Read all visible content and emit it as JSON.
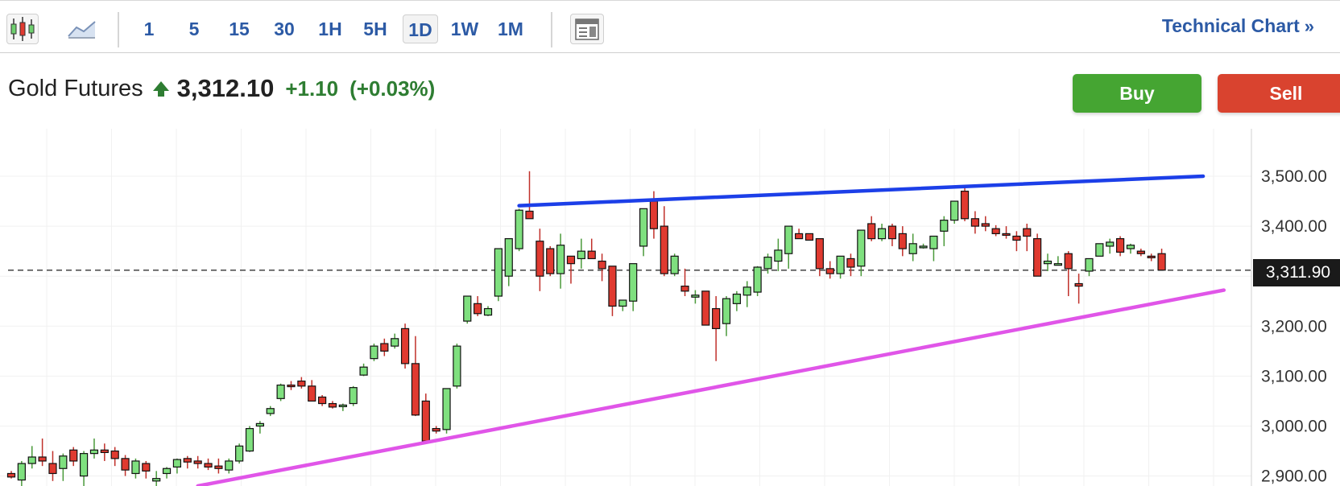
{
  "toolbar": {
    "chart_type_icons": [
      "candlestick-icon",
      "area-chart-icon"
    ],
    "intervals": [
      "1",
      "5",
      "15",
      "30",
      "1H",
      "5H",
      "1D",
      "1W",
      "1M"
    ],
    "active_interval": "1D",
    "layout_icon": "layout-icon",
    "technical_chart_label": "Technical Chart",
    "technical_chart_arrow": "»"
  },
  "quote": {
    "name": "Gold Futures",
    "direction_icon": "arrow-up-icon",
    "price": "3,312.10",
    "change": "+1.10",
    "change_pct": "(+0.03%)",
    "positive_color": "#2e7d32"
  },
  "actions": {
    "buy_label": "Buy",
    "sell_label": "Sell",
    "buy_color": "#45a532",
    "sell_color": "#d9432f"
  },
  "chart_data": {
    "type": "candlestick",
    "instrument": "Gold Futures",
    "interval": "1D",
    "y_ticks": [
      "3,500.00",
      "3,400.00",
      "3,300.00",
      "3,200.00",
      "3,100.00",
      "3,000.00",
      "2,900.00"
    ],
    "y_tick_values": [
      3500,
      3400,
      3300,
      3200,
      3100,
      3000,
      2900
    ],
    "ylim": [
      2880,
      3595
    ],
    "grid": true,
    "current_price_label": "3,311.90",
    "current_price": 3311.9,
    "up_color": "#7fe07f",
    "down_color": "#e03a30",
    "candles": [
      [
        2905,
        2910,
        2895,
        2898
      ],
      [
        2892,
        2930,
        2880,
        2925
      ],
      [
        2925,
        2960,
        2915,
        2938
      ],
      [
        2938,
        2975,
        2920,
        2930
      ],
      [
        2925,
        2950,
        2890,
        2905
      ],
      [
        2915,
        2945,
        2890,
        2940
      ],
      [
        2952,
        2958,
        2920,
        2930
      ],
      [
        2900,
        2950,
        2880,
        2945
      ],
      [
        2945,
        2975,
        2935,
        2952
      ],
      [
        2952,
        2965,
        2930,
        2947
      ],
      [
        2950,
        2958,
        2920,
        2935
      ],
      [
        2935,
        2942,
        2900,
        2912
      ],
      [
        2905,
        2935,
        2895,
        2930
      ],
      [
        2925,
        2930,
        2895,
        2910
      ],
      [
        2890,
        2910,
        2878,
        2895
      ],
      [
        2905,
        2918,
        2895,
        2915
      ],
      [
        2918,
        2935,
        2905,
        2933
      ],
      [
        2935,
        2940,
        2915,
        2928
      ],
      [
        2930,
        2940,
        2915,
        2925
      ],
      [
        2925,
        2935,
        2912,
        2918
      ],
      [
        2920,
        2935,
        2905,
        2915
      ],
      [
        2912,
        2935,
        2905,
        2930
      ],
      [
        2930,
        2965,
        2925,
        2960
      ],
      [
        2950,
        3000,
        2948,
        2995
      ],
      [
        3000,
        3010,
        2985,
        3005
      ],
      [
        3025,
        3040,
        3020,
        3035
      ],
      [
        3055,
        3085,
        3050,
        3082
      ],
      [
        3082,
        3090,
        3072,
        3080
      ],
      [
        3090,
        3098,
        3075,
        3080
      ],
      [
        3080,
        3092,
        3050,
        3050
      ],
      [
        3058,
        3062,
        3040,
        3045
      ],
      [
        3045,
        3050,
        3035,
        3038
      ],
      [
        3040,
        3045,
        3030,
        3042
      ],
      [
        3045,
        3080,
        3040,
        3077
      ],
      [
        3102,
        3125,
        3100,
        3118
      ],
      [
        3135,
        3165,
        3130,
        3160
      ],
      [
        3165,
        3175,
        3140,
        3150
      ],
      [
        3160,
        3185,
        3155,
        3175
      ],
      [
        3195,
        3205,
        3115,
        3125
      ],
      [
        3125,
        3180,
        3020,
        3022
      ],
      [
        3050,
        3065,
        2965,
        2970
      ],
      [
        2995,
        3000,
        2985,
        2990
      ],
      [
        2993,
        3075,
        2985,
        3075
      ],
      [
        3080,
        3165,
        3075,
        3160
      ],
      [
        3210,
        3260,
        3205,
        3260
      ],
      [
        3245,
        3260,
        3220,
        3225
      ],
      [
        3222,
        3240,
        3220,
        3235
      ],
      [
        3260,
        3310,
        3250,
        3355
      ],
      [
        3300,
        3375,
        3280,
        3375
      ],
      [
        3355,
        3435,
        3350,
        3432
      ],
      [
        3430,
        3510,
        3420,
        3415
      ],
      [
        3370,
        3395,
        3270,
        3300
      ],
      [
        3355,
        3360,
        3300,
        3305
      ],
      [
        3305,
        3385,
        3275,
        3362
      ],
      [
        3340,
        3330,
        3285,
        3325
      ],
      [
        3335,
        3375,
        3315,
        3350
      ],
      [
        3350,
        3375,
        3340,
        3335
      ],
      [
        3330,
        3345,
        3290,
        3315
      ],
      [
        3320,
        3320,
        3220,
        3240
      ],
      [
        3240,
        3245,
        3230,
        3252
      ],
      [
        3250,
        3320,
        3230,
        3325
      ],
      [
        3360,
        3435,
        3340,
        3435
      ],
      [
        3450,
        3470,
        3375,
        3395
      ],
      [
        3400,
        3440,
        3300,
        3305
      ],
      [
        3305,
        3345,
        3300,
        3340
      ],
      [
        3280,
        3315,
        3260,
        3270
      ],
      [
        3258,
        3272,
        3245,
        3262
      ],
      [
        3270,
        3270,
        3235,
        3202
      ],
      [
        3235,
        3260,
        3130,
        3195
      ],
      [
        3205,
        3260,
        3180,
        3255
      ],
      [
        3245,
        3270,
        3230,
        3264
      ],
      [
        3262,
        3290,
        3238,
        3278
      ],
      [
        3268,
        3320,
        3260,
        3318
      ],
      [
        3315,
        3345,
        3305,
        3338
      ],
      [
        3330,
        3375,
        3310,
        3352
      ],
      [
        3345,
        3400,
        3315,
        3400
      ],
      [
        3385,
        3395,
        3380,
        3375
      ],
      [
        3385,
        3385,
        3375,
        3372
      ],
      [
        3375,
        3375,
        3300,
        3315
      ],
      [
        3315,
        3330,
        3295,
        3305
      ],
      [
        3305,
        3340,
        3295,
        3340
      ],
      [
        3335,
        3345,
        3300,
        3318
      ],
      [
        3320,
        3390,
        3300,
        3392
      ],
      [
        3405,
        3420,
        3370,
        3375
      ],
      [
        3375,
        3405,
        3370,
        3395
      ],
      [
        3400,
        3405,
        3360,
        3375
      ],
      [
        3385,
        3400,
        3340,
        3355
      ],
      [
        3345,
        3385,
        3330,
        3365
      ],
      [
        3360,
        3365,
        3355,
        3360
      ],
      [
        3355,
        3380,
        3330,
        3380
      ],
      [
        3390,
        3420,
        3360,
        3412
      ],
      [
        3412,
        3450,
        3405,
        3450
      ],
      [
        3470,
        3480,
        3410,
        3415
      ],
      [
        3415,
        3430,
        3385,
        3400
      ],
      [
        3405,
        3420,
        3390,
        3400
      ],
      [
        3395,
        3402,
        3380,
        3385
      ],
      [
        3385,
        3400,
        3375,
        3382
      ],
      [
        3380,
        3390,
        3350,
        3372
      ],
      [
        3395,
        3405,
        3350,
        3380
      ],
      [
        3375,
        3385,
        3300,
        3300
      ],
      [
        3325,
        3345,
        3310,
        3330
      ],
      [
        3325,
        3340,
        3325,
        3325
      ],
      [
        3345,
        3350,
        3260,
        3315
      ],
      [
        3285,
        3305,
        3245,
        3280
      ],
      [
        3310,
        3330,
        3300,
        3335
      ],
      [
        3340,
        3365,
        3340,
        3365
      ],
      [
        3360,
        3375,
        3345,
        3368
      ],
      [
        3375,
        3380,
        3340,
        3348
      ],
      [
        3355,
        3365,
        3345,
        3362
      ],
      [
        3350,
        3355,
        3340,
        3345
      ],
      [
        3340,
        3345,
        3330,
        3338
      ],
      [
        3345,
        3355,
        3330,
        3312
      ]
    ],
    "trendlines": [
      {
        "name": "upper-resistance",
        "color": "#1c3fe8",
        "from": [
          49,
          3441
        ],
        "to": [
          115,
          3500
        ]
      },
      {
        "name": "lower-support",
        "color": "#e055e8",
        "from": [
          18,
          2880
        ],
        "to": [
          117,
          3272
        ]
      }
    ]
  }
}
